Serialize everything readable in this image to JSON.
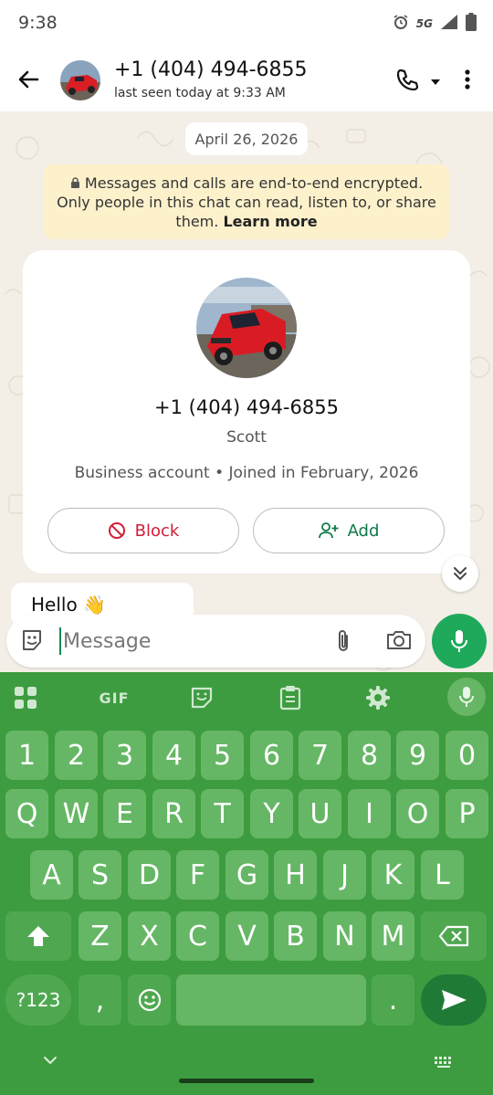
{
  "status_bar": {
    "time": "9:38",
    "network": "5G"
  },
  "header": {
    "contact_name": "+1 (404) 494-6855",
    "last_seen": "last seen today at 9:33 AM"
  },
  "chat": {
    "date_chip": "April 26, 2026",
    "encryption_notice": "Messages and calls are end-to-end encrypted. Only people in this chat can read, listen to, or share them.",
    "learn_more": "Learn more",
    "business_card": {
      "phone": "+1 (404) 494-6855",
      "name": "Scott",
      "info": "Business account • Joined in February, 2026",
      "block_label": "Block",
      "add_label": "Add"
    },
    "messages": [
      {
        "text": "Hello 👋"
      }
    ]
  },
  "composer": {
    "placeholder": "Message"
  },
  "keyboard": {
    "gif_label": "GIF",
    "number_row": [
      "1",
      "2",
      "3",
      "4",
      "5",
      "6",
      "7",
      "8",
      "9",
      "0"
    ],
    "row1": [
      "Q",
      "W",
      "E",
      "R",
      "T",
      "Y",
      "U",
      "I",
      "O",
      "P"
    ],
    "row2": [
      "A",
      "S",
      "D",
      "F",
      "G",
      "H",
      "J",
      "K",
      "L"
    ],
    "row3": [
      "Z",
      "X",
      "C",
      "V",
      "B",
      "N",
      "M"
    ],
    "symbols_label": "?123",
    "comma": ",",
    "period": "."
  },
  "colors": {
    "accent_green": "#1faa5b",
    "keyboard_bg": "#3d9c3f",
    "block_red": "#d21c35",
    "add_green": "#0e7a48",
    "encryption_bg": "#fdf1cc"
  }
}
